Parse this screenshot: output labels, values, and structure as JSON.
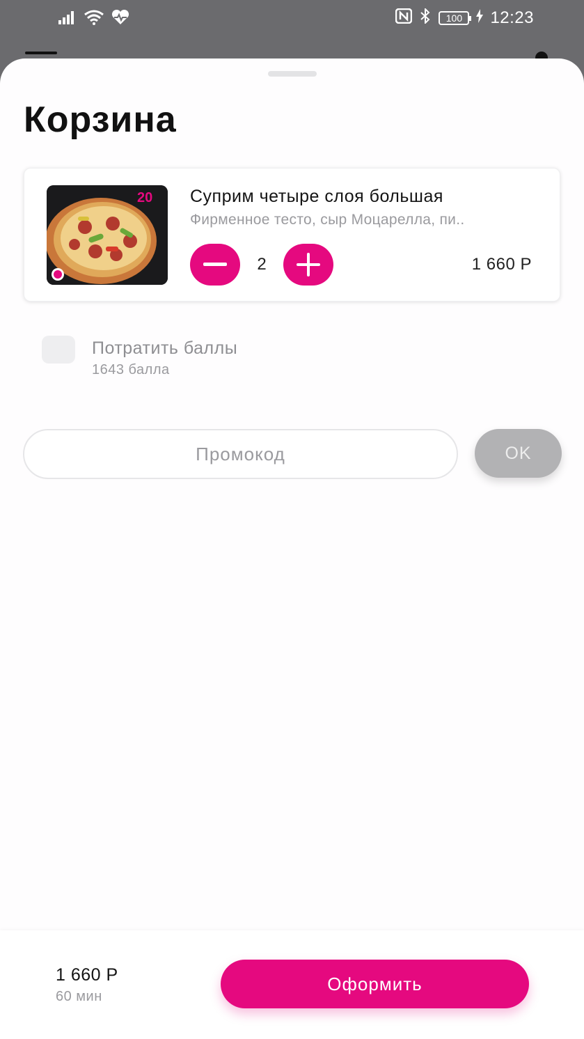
{
  "status_bar": {
    "time": "12:23",
    "battery": "100",
    "icons": [
      "signal-icon",
      "wifi-icon",
      "heart-rate-icon",
      "nfc-icon",
      "bluetooth-icon",
      "battery-icon",
      "charging-icon"
    ]
  },
  "cart": {
    "title": "Корзина",
    "items": [
      {
        "name": "Суприм четыре слоя большая",
        "description": "Фирменное тесто, сыр Моцарелла, пи..",
        "quantity": "2",
        "price": "1 660 Р",
        "image": "pizza-photo"
      }
    ],
    "points": {
      "label": "Потратить баллы",
      "balance": "1643 балла",
      "checked": false
    },
    "promo": {
      "placeholder": "Промокод",
      "value": "",
      "ok_label": "OK"
    }
  },
  "footer": {
    "total": "1 660 Р",
    "delivery_time": "60 мин",
    "checkout_label": "Оформить"
  },
  "colors": {
    "accent": "#e5097f",
    "disabled_button": "#b2b2b4",
    "muted_text": "#9a9a9e"
  }
}
